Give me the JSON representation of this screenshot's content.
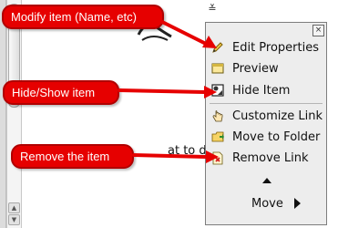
{
  "background_text": "at to do? M",
  "menu": {
    "toggle_glyph": "≚",
    "close_glyph": "×",
    "items": [
      {
        "label": "Edit Properties",
        "icon": "pencil-icon"
      },
      {
        "label": "Preview",
        "icon": "window-icon"
      },
      {
        "label": "Hide Item",
        "icon": "hide-icon"
      },
      {
        "label": "Customize Link",
        "icon": "hand-icon"
      },
      {
        "label": "Move to Folder",
        "icon": "folder-icon"
      },
      {
        "label": "Remove Link",
        "icon": "remove-doc-icon"
      }
    ],
    "move_label": "Move"
  },
  "callouts": {
    "modify": "Modify item (Name, etc)",
    "hide_show": "Hide/Show item",
    "remove": "Remove the item"
  },
  "colors": {
    "callout_red": "#e60000",
    "menu_bg": "#ededed"
  }
}
